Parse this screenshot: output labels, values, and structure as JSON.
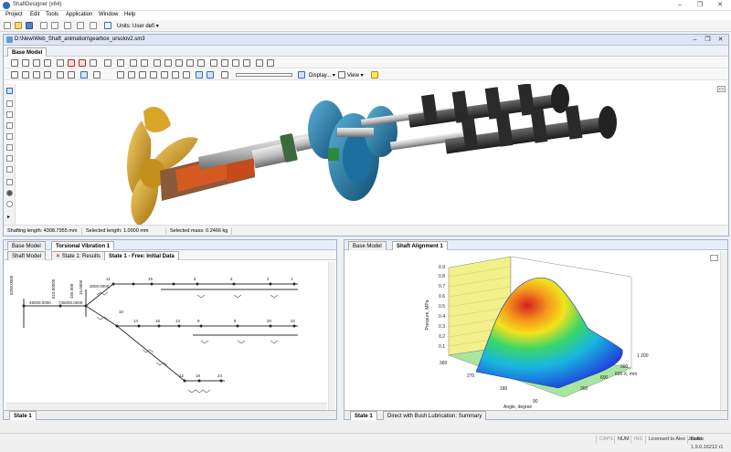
{
  "app": {
    "title": "ShaftDesigner (x64)"
  },
  "menu": [
    "Project",
    "Edit",
    "Tools",
    "Application",
    "Window",
    "Help"
  ],
  "toolbar": {
    "units_label": "Units: User defi",
    "units_arrow": "▾"
  },
  "document": {
    "path": "D:\\New\\Web_Shaft_animation\\gearbox_ursolov2.sm3",
    "tab_base_model": "Base Model",
    "display_label": "Display...",
    "view_label": "View",
    "status": {
      "shafting_length": "Shafting length: 4308.7955 mm",
      "selected_length": "Selected length: 1.0000 mm",
      "selected_mass": "Selected mass: 0.2466 kg"
    }
  },
  "left_pane": {
    "tabs": [
      "Base Model",
      "Torsional Vibration 1"
    ],
    "subtabs": [
      "Shaft Model",
      "State 1: Results",
      "State 1 - Free: Initial Data"
    ],
    "bottom_tab": "State 1",
    "diagram": {
      "labels_top": [
        "49000.0000",
        "735000.0000",
        "3000.0000",
        "11",
        "15",
        "6",
        "4",
        "2",
        "1"
      ],
      "labels_mid": [
        "14",
        "16",
        "13",
        "9",
        "8",
        "20",
        "22"
      ],
      "labels_bot": [
        "10",
        "12",
        "18",
        "24"
      ],
      "side_labels": [
        "6250.0000",
        "810.00000",
        "455.000",
        "15.0000"
      ]
    }
  },
  "right_pane": {
    "tabs": [
      "Base Model",
      "Shaft Alignment 1"
    ],
    "bottom_tabs": [
      "State 1",
      "Direct with Bush Lubrication: Summary"
    ],
    "chart_title": "",
    "colors": {
      "peak": "#d62020",
      "mid": "#f2e21b",
      "low": "#1f3fd9",
      "wall_left": "#f2f08a",
      "floor": "#a8e6a0"
    }
  },
  "chart_data": {
    "type": "surface3d",
    "title": "",
    "zlabel": "Pressure, MPa",
    "z_ticks": [
      "0.1",
      "0.2",
      "0.3",
      "0.4",
      "0.5",
      "0.6",
      "0.7",
      "0.8",
      "0.9"
    ],
    "ylabel": "600 X, mm",
    "y_ticks": [
      "1 200",
      "900",
      "600",
      "300"
    ],
    "xlabel": "Angle, degree",
    "x_ticks": [
      "360",
      "270",
      "180",
      "90"
    ],
    "peak_pressure_approx": 0.9
  },
  "statusbar": {
    "caps": "CAPS",
    "num": "NUM",
    "ins": "INS",
    "licensed": "Licensed to Alex Ursolov",
    "build": "Build 1.9.0.16212 r1"
  }
}
